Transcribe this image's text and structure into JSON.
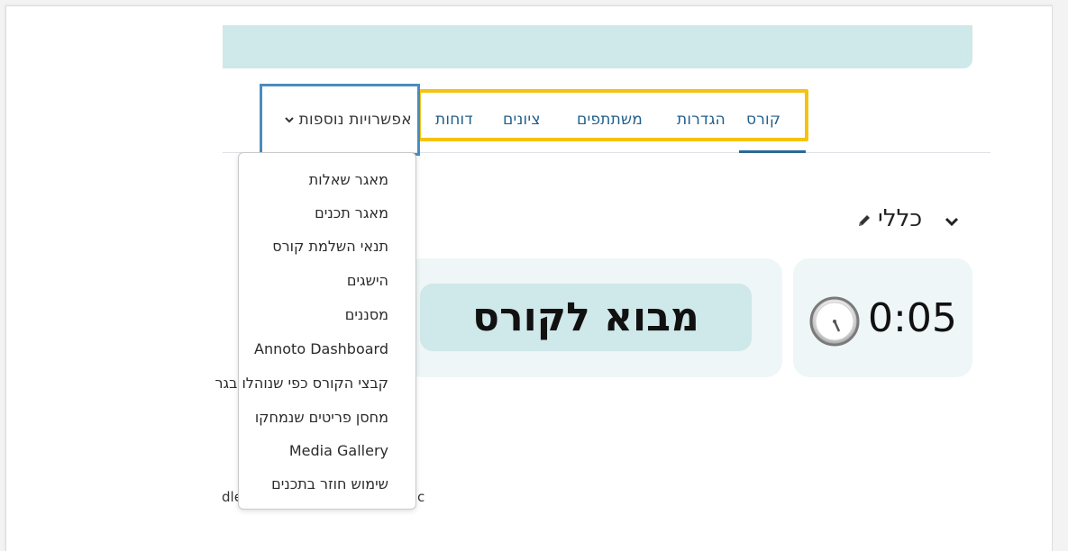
{
  "nav": {
    "items": [
      {
        "label": "קורס"
      },
      {
        "label": "הגדרות"
      },
      {
        "label": "משתתפים"
      },
      {
        "label": "ציונים"
      },
      {
        "label": "דוחות"
      }
    ],
    "more_label": "אפשרויות נוספות"
  },
  "dropdown": {
    "items": [
      {
        "label": "מאגר שאלות"
      },
      {
        "label": "מאגר תכנים"
      },
      {
        "label": "תנאי השלמת קורס"
      },
      {
        "label": "הישגים"
      },
      {
        "label": "מסננים"
      },
      {
        "label": "Annoto Dashboard"
      },
      {
        "label": "קבצי הקורס כפי שנוהלו בגר"
      },
      {
        "label": "מחסן פריטים שנמחקו"
      },
      {
        "label": "Media Gallery"
      },
      {
        "label": "שימוש חוזר בתכנים"
      }
    ]
  },
  "section": {
    "title": "כללי"
  },
  "cards": {
    "intro_label": "מבוא לקורס",
    "time_label": "0:05"
  },
  "background_text": {
    "left_fragment": "קבצי הקורס כפי שנוהלו בגר",
    "dle_fragment": "dle",
    "c_fragment": "c"
  },
  "colors": {
    "header_band": "#cfe8ea",
    "card_bg": "#eef6f7",
    "nav_link": "#1f5f8b",
    "highlight_yellow": "#f5c211",
    "highlight_blue": "#4a8cc0"
  },
  "icons": {
    "section_toggle": "chevron-down-icon",
    "edit": "pencil-icon",
    "timer": "clock-icon",
    "more_toggle": "chevron-down-icon"
  }
}
